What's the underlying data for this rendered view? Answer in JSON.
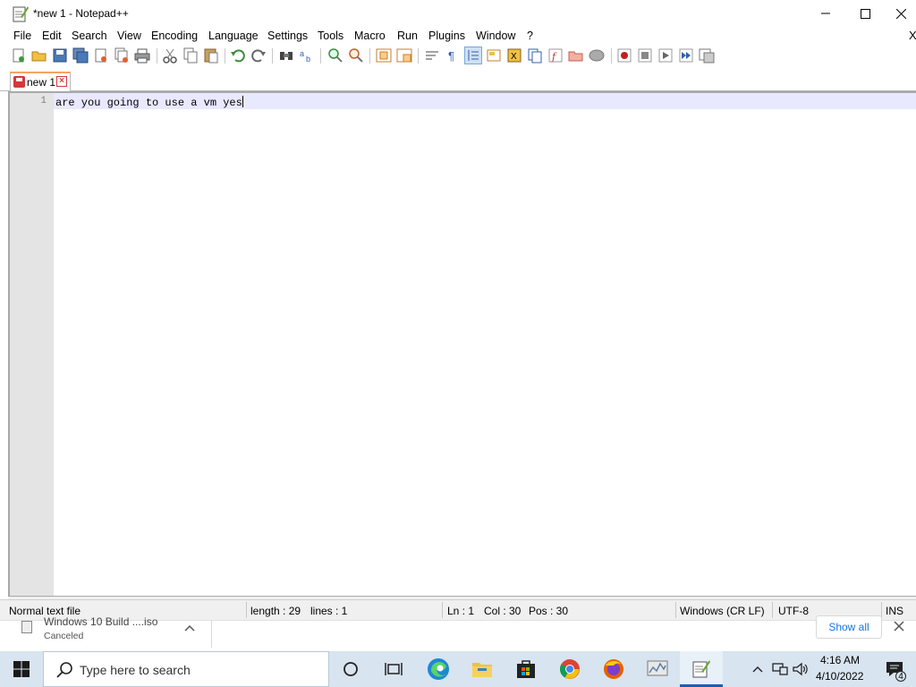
{
  "window": {
    "title": "*new 1 - Notepad++",
    "minimize_glyph": "—",
    "close_glyph": "✕"
  },
  "menu": [
    "File",
    "Edit",
    "Search",
    "View",
    "Encoding",
    "Language",
    "Settings",
    "Tools",
    "Macro",
    "Run",
    "Plugins",
    "Window",
    "?"
  ],
  "menu_close_glyph": "X",
  "tabs": [
    {
      "label": "new 1",
      "modified": true
    }
  ],
  "editor": {
    "line_number": "1",
    "text": "are you going to use a vm yes"
  },
  "status": {
    "file_type": "Normal text file",
    "length": "length : 29",
    "lines": "lines : 1",
    "ln": "Ln : 1",
    "col": "Col : 30",
    "pos": "Pos : 30",
    "eol": "Windows (CR LF)",
    "encoding": "UTF-8",
    "mode": "INS"
  },
  "download": {
    "filename": "Windows 10 Build ....iso",
    "status": "Canceled",
    "show_all": "Show all"
  },
  "taskbar": {
    "search_placeholder": "Type here to search",
    "time": "4:16 AM",
    "date": "4/10/2022",
    "notification_count": "4"
  },
  "colors": {
    "accent": "#1a73e8",
    "tab_modified": "#d83838",
    "current_line": "#e8e8ff",
    "taskbar": "#d8e4f0"
  }
}
